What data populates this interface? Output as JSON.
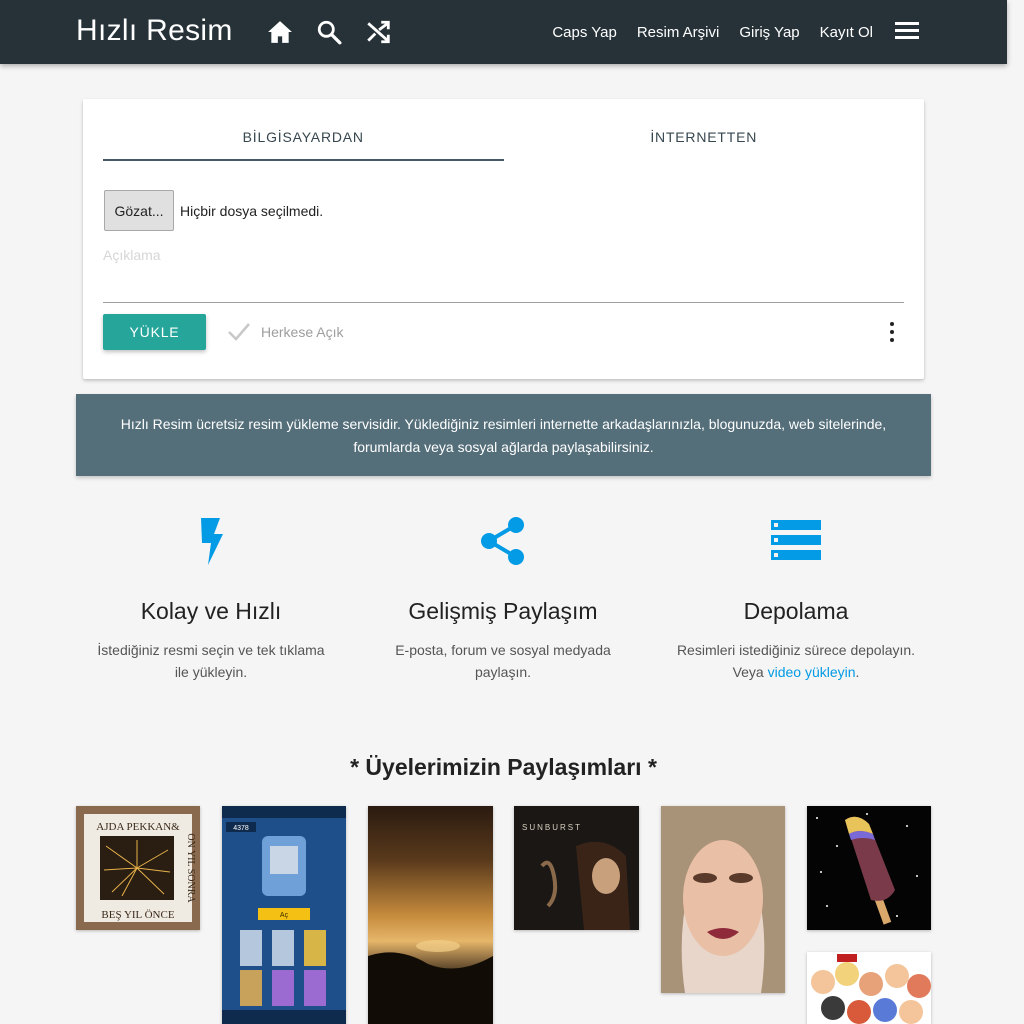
{
  "nav": {
    "brand": "Hızlı Resim",
    "icons": [
      "home-icon",
      "search-icon",
      "shuffle-icon"
    ],
    "links": [
      "Caps Yap",
      "Resim Arşivi",
      "Giriş Yap",
      "Kayıt Ol"
    ],
    "menu_icon": "hamburger-menu-icon",
    "bg_color": "#263238"
  },
  "upload": {
    "tabs": [
      "BİLGİSAYARDAN",
      "İNTERNETTEN"
    ],
    "active_tab": 0,
    "file_button": "Gözat...",
    "file_status": "Hiçbir dosya seçilmedi.",
    "description_placeholder": "Açıklama",
    "description_value": "",
    "upload_button": "YÜKLE",
    "public_label": "Herkese Açık",
    "public_checked": false,
    "accent_color": "#26a69a"
  },
  "info": {
    "line1": "Hızlı Resim ücretsiz resim yükleme servisidir. Yüklediğiniz resimleri internette arkadaşlarınızla, blogunuzda, web sitelerinde,",
    "line2": "forumlarda veya sosyal ağlarda paylaşabilirsiniz.",
    "bg_color": "#546e7a"
  },
  "features": [
    {
      "icon": "lightning-icon",
      "title": "Kolay ve Hızlı",
      "line1": "İstediğiniz resmi seçin ve tek tıklama",
      "line2": "ile yükleyin."
    },
    {
      "icon": "share-icon",
      "title": "Gelişmiş Paylaşım",
      "line1": "E-posta, forum ve sosyal medyada",
      "line2": "paylaşın."
    },
    {
      "icon": "storage-icon",
      "title": "Depolama",
      "line1": "Resimleri istediğiniz sürece depolayın.",
      "line2_prefix": "Veya ",
      "line2_link": "video yükleyin",
      "line2_suffix": "."
    }
  ],
  "feature_icon_color": "#039be5",
  "gallery": {
    "title": "* Üyelerimizin Paylaşımları *",
    "thumbs": [
      {
        "name": "book-cover-thumb",
        "text_lines": [
          "AJDA PEKKAN&",
          "BEŞ YIL ÖNCE",
          "ON YIL SONRA"
        ]
      },
      {
        "name": "game-screenshot-thumb",
        "text_lines": [
          "4378",
          "Aç"
        ]
      },
      {
        "name": "sunset-thumb"
      },
      {
        "name": "album-cover-thumb",
        "text_lines": [
          "SUNBURST"
        ]
      },
      {
        "name": "makeup-portrait-thumb"
      },
      {
        "name": "popsicle-thumb"
      },
      {
        "name": "cartoon-collage-thumb"
      }
    ]
  }
}
